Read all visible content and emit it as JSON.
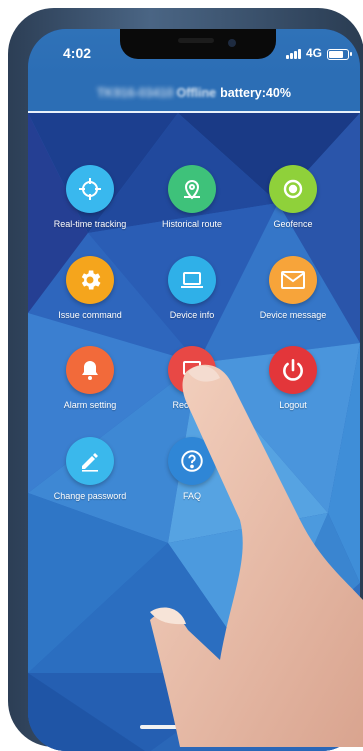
{
  "status_bar": {
    "time": "4:02",
    "network": "4G",
    "battery_level": 0.85
  },
  "header": {
    "device_id": "TK916-03410",
    "device_state": "Offline",
    "battery_text": "battery:40%"
  },
  "menu": [
    {
      "label": "Real-time tracking",
      "icon": "crosshair-icon",
      "color": "#39b8ee"
    },
    {
      "label": "Historical route",
      "icon": "map-pin-icon",
      "color": "#3ec27a"
    },
    {
      "label": "Geofence",
      "icon": "target-icon",
      "color": "#8fd13a"
    },
    {
      "label": "Issue command",
      "icon": "gear-icon",
      "color": "#f5a51c"
    },
    {
      "label": "Device info",
      "icon": "laptop-icon",
      "color": "#2fb0e8"
    },
    {
      "label": "Device message",
      "icon": "envelope-icon",
      "color": "#f7a43a"
    },
    {
      "label": "Alarm setting",
      "icon": "bell-icon",
      "color": "#f26a3a"
    },
    {
      "label": "Recharge",
      "icon": "recharge-icon",
      "color": "#e84845"
    },
    {
      "label": "Logout",
      "icon": "power-icon",
      "color": "#e3363a"
    },
    {
      "label": "Change password",
      "icon": "pencil-icon",
      "color": "#3ab8ec"
    },
    {
      "label": "FAQ",
      "icon": "question-icon",
      "color": "#2f86d6"
    }
  ]
}
